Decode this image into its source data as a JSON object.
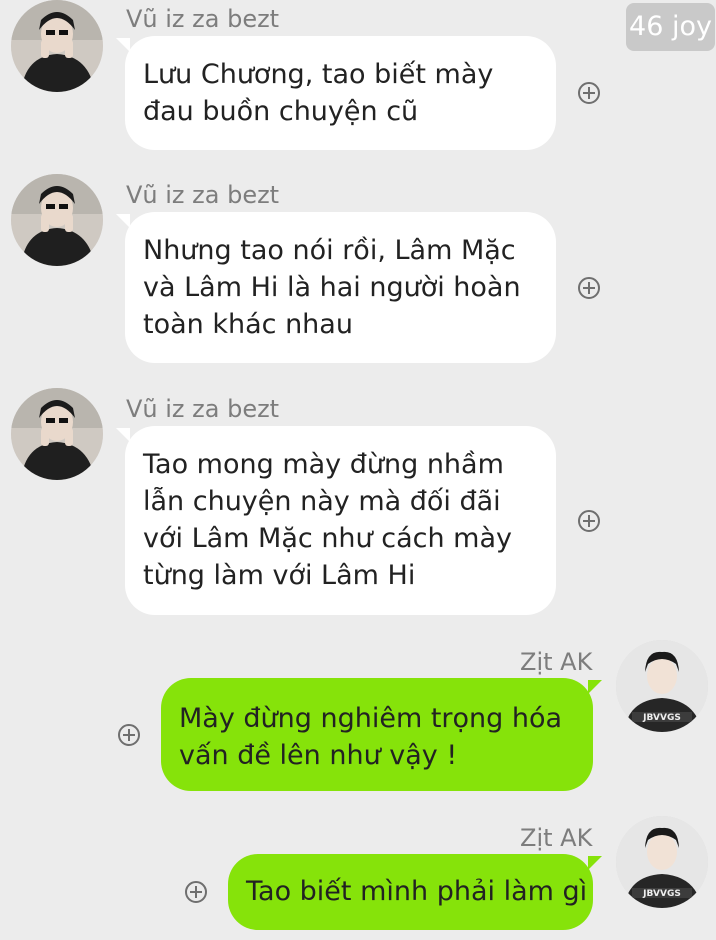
{
  "watermark": "46 joy",
  "colors": {
    "background": "#ececec",
    "incoming_bubble": "#ffffff",
    "outgoing_bubble": "#86e30a",
    "sender_name": "#7d7d7d"
  },
  "messages": [
    {
      "direction": "incoming",
      "sender": "Vũ iz za bezt",
      "lines": [
        "Lưu Chương, tao biết mày",
        "đau buồn chuyện cũ"
      ],
      "avatar_icon": "user-avatar-icon",
      "action_icon": "add-circle-icon"
    },
    {
      "direction": "incoming",
      "sender": "Vũ iz za bezt",
      "lines": [
        "Nhưng tao nói rồi, Lâm Mặc",
        "và Lâm Hi là hai người hoàn",
        "toàn khác nhau"
      ],
      "avatar_icon": "user-avatar-icon",
      "action_icon": "add-circle-icon"
    },
    {
      "direction": "incoming",
      "sender": "Vũ iz za bezt",
      "lines": [
        "Tao mong mày đừng nhầm",
        "lẫn chuyện này mà đối đãi",
        "với Lâm Mặc như cách mày",
        "từng làm với Lâm Hi"
      ],
      "avatar_icon": "user-avatar-icon",
      "action_icon": "add-circle-icon"
    },
    {
      "direction": "outgoing",
      "sender": "Zịt AK",
      "lines": [
        "Mày đừng nghiêm trọng hóa",
        "vấn đề lên như vậy !"
      ],
      "avatar_icon": "user-avatar-icon",
      "action_icon": "add-circle-icon"
    },
    {
      "direction": "outgoing",
      "sender": "Zịt AK",
      "lines": [
        "Tao biết mình phải làm gì"
      ],
      "avatar_icon": "user-avatar-icon",
      "action_icon": "add-circle-icon"
    }
  ]
}
